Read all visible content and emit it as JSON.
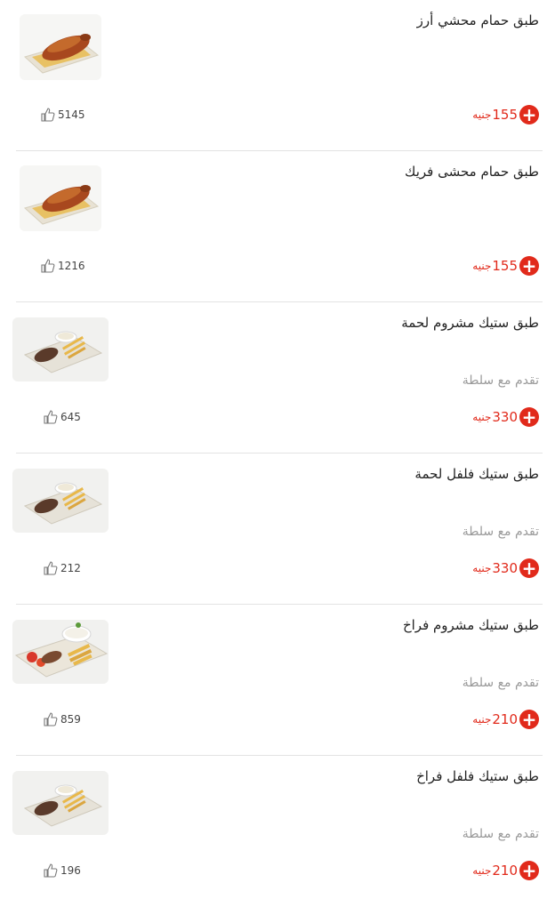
{
  "currency": "جنيه",
  "items": [
    {
      "title": "طبق حمام محشي أرز",
      "desc": "",
      "price": "155",
      "likes": "5145",
      "image": "pigeon"
    },
    {
      "title": "طبق حمام محشى فريك",
      "desc": "",
      "price": "155",
      "likes": "1216",
      "image": "pigeon"
    },
    {
      "title": "طبق ستيك مشروم لحمة",
      "desc": "تقدم مع سلطة",
      "price": "330",
      "likes": "645",
      "image": "steak"
    },
    {
      "title": "طبق ستيك فلفل لحمة",
      "desc": "تقدم مع سلطة",
      "price": "330",
      "likes": "212",
      "image": "steak"
    },
    {
      "title": "طبق ستيك مشروم فراخ",
      "desc": "تقدم مع سلطة",
      "price": "210",
      "likes": "859",
      "image": "chicken-steak"
    },
    {
      "title": "طبق ستيك فلفل فراخ",
      "desc": "تقدم مع سلطة",
      "price": "210",
      "likes": "196",
      "image": "steak"
    }
  ],
  "colors": {
    "accent": "#e12a1b",
    "divider": "#e3e3e3",
    "muted": "#9a9a9a"
  },
  "icons": {
    "add": "plus-circle-icon",
    "like": "thumbs-up-icon"
  }
}
